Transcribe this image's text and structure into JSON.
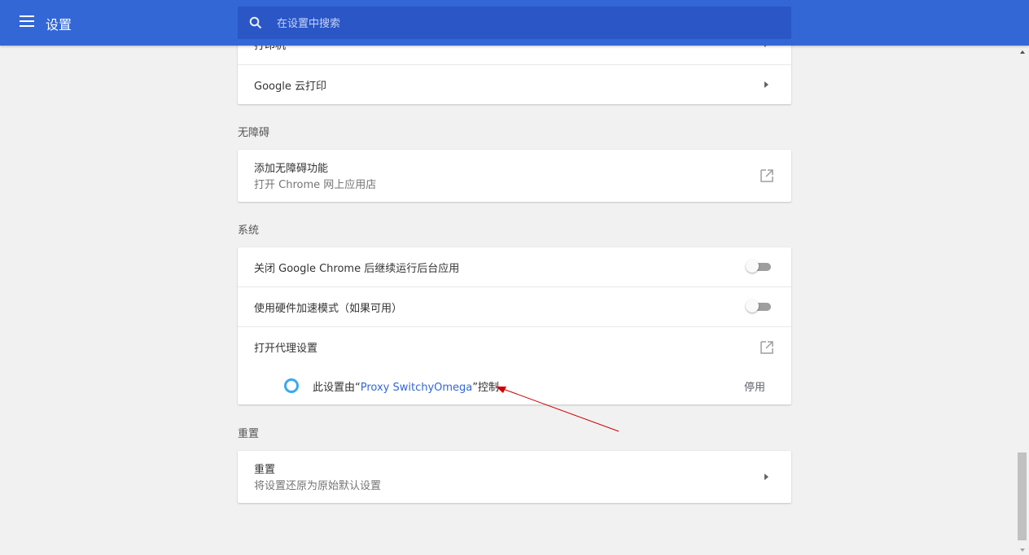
{
  "header": {
    "title": "设置",
    "menu_icon": "hamburger-menu-icon",
    "search_icon": "search-icon",
    "search_placeholder": "在设置中搜索",
    "background_color": "#3367d6"
  },
  "printing": {
    "partial_item_label": "打印机",
    "cloud_print_label": "Google 云打印"
  },
  "accessibility": {
    "section_title": "无障碍",
    "add_features_label": "添加无障碍功能",
    "add_features_sublabel": "打开 Chrome 网上应用店"
  },
  "system": {
    "section_title": "系统",
    "background_apps_label": "关闭 Google Chrome 后继续运行后台应用",
    "background_apps_enabled": false,
    "hardware_accel_label": "使用硬件加速模式（如果可用）",
    "hardware_accel_enabled": false,
    "proxy_label": "打开代理设置",
    "proxy_controlled_prefix": "此设置由“",
    "proxy_controlled_extension": "Proxy SwitchyOmega",
    "proxy_controlled_suffix": "”控制",
    "disable_label": "停用"
  },
  "reset": {
    "section_title": "重置",
    "reset_label": "重置",
    "reset_sublabel": "将设置还原为原始默认设置"
  },
  "annotation_color": "#cc0000"
}
